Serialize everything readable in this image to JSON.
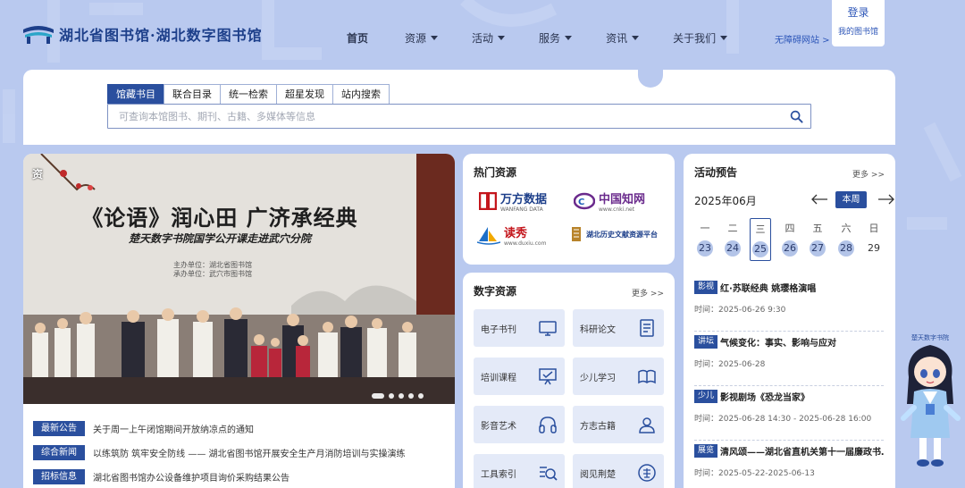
{
  "header": {
    "logo_text": "湖北省图书馆·湖北数字图书馆",
    "nav": [
      {
        "label": "首页",
        "has_dropdown": false
      },
      {
        "label": "资源",
        "has_dropdown": true
      },
      {
        "label": "活动",
        "has_dropdown": true
      },
      {
        "label": "服务",
        "has_dropdown": true
      },
      {
        "label": "资讯",
        "has_dropdown": true
      },
      {
        "label": "关于我们",
        "has_dropdown": true
      }
    ],
    "accessibility_link": "无障碍网站 >",
    "login": "登录",
    "my_library": "我的图书馆"
  },
  "search": {
    "tabs": [
      "馆藏书目",
      "联合目录",
      "统一检索",
      "超星发现",
      "站内搜索"
    ],
    "active_tab": "馆藏书目",
    "placeholder": "可查询本馆图书、期刊、古籍、多媒体等信息"
  },
  "banner": {
    "label": "资",
    "title": "《论语》润心田 广济承经典",
    "subtitle": "楚天数字书院国学公开课走进武穴分院",
    "org_lines": [
      "主办单位：湖北省图书馆",
      "承办单位：武穴市图书馆"
    ],
    "slide_count": 6
  },
  "news": [
    {
      "tag": "最新公告",
      "text": "关于周一上午闭馆期间开放纳凉点的通知"
    },
    {
      "tag": "综合新闻",
      "text": "以练筑防 筑牢安全防线 —— 湖北省图书馆开展安全生产月消防培训与实操演练"
    },
    {
      "tag": "招标信息",
      "text": "湖北省图书馆办公设备维护项目询价采购结果公告"
    }
  ],
  "hot_resources": {
    "title": "热门资源",
    "items": [
      {
        "name": "万方数据",
        "sub": "WANFANG DATA",
        "icon": "wanfang-logo"
      },
      {
        "name": "中国知网",
        "sub": "www.cnki.net",
        "icon": "cnki-logo"
      },
      {
        "name": "读秀",
        "sub": "www.duxiu.com",
        "icon": "duxiu-logo"
      },
      {
        "name": "湖北历史文献资源平台",
        "sub": "",
        "icon": "hubei-history-logo"
      }
    ]
  },
  "digital_resources": {
    "title": "数字资源",
    "more": "更多 >>",
    "items": [
      {
        "label": "电子书刊",
        "icon": "monitor-icon"
      },
      {
        "label": "科研论文",
        "icon": "document-icon"
      },
      {
        "label": "培训课程",
        "icon": "presentation-icon"
      },
      {
        "label": "少儿学习",
        "icon": "open-book-icon"
      },
      {
        "label": "影音艺术",
        "icon": "headphones-icon"
      },
      {
        "label": "方志古籍",
        "icon": "scroll-icon"
      },
      {
        "label": "工具索引",
        "icon": "magnifier-icon"
      },
      {
        "label": "阅见荆楚",
        "icon": "chu-seal-icon"
      }
    ]
  },
  "activity": {
    "title": "活动预告",
    "more": "更多 >>",
    "month": "2025年06月",
    "week_button": "本周",
    "days": [
      {
        "weekday": "一",
        "date": "23"
      },
      {
        "weekday": "二",
        "date": "24"
      },
      {
        "weekday": "三",
        "date": "25",
        "today": true
      },
      {
        "weekday": "四",
        "date": "26"
      },
      {
        "weekday": "五",
        "date": "27"
      },
      {
        "weekday": "六",
        "date": "28"
      },
      {
        "weekday": "日",
        "date": "29",
        "plain": true
      }
    ],
    "events": [
      {
        "tag": "影视",
        "title": "红·苏联经典 姚璎格演唱",
        "time": "时间：2025-06-26 9:30"
      },
      {
        "tag": "讲坛",
        "title": "气候变化：事实、影响与应对",
        "time": "时间：2025-06-28"
      },
      {
        "tag": "少儿",
        "title": "影视剧场《恐龙当家》",
        "time": "时间：2025-06-28 14:30 - 2025-06-28 16:00"
      },
      {
        "tag": "展览",
        "title": "清风颂——湖北省直机关第十一届廉政书…",
        "time": "时间：2025-05-22-2025-06-13"
      }
    ]
  },
  "mascot_sign": "楚天数字书院",
  "colors": {
    "primary": "#2a4f9e",
    "background": "#b9c9ef",
    "tile": "#e4eaf8"
  }
}
